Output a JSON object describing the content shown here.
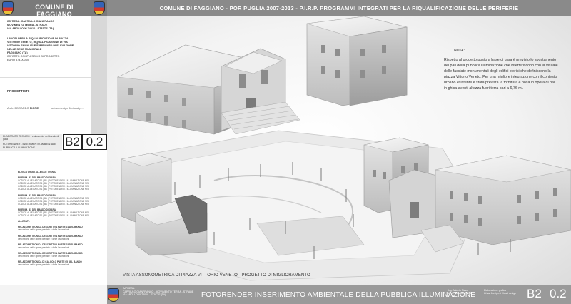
{
  "header": {
    "municipality": "COMUNE DI FAGGIANO",
    "program_title": "COMUNE DI FAGGIANO - POR PUGLIA 2007-2013 - P.I.R.P. PROGRAMMI INTEGRATI PER LA RIQUALIFICAZIONE DELLE PERIFERIE"
  },
  "info": {
    "impresa": "IMPRESA: CAPRIULO GIANFRANCO",
    "company": "MOVIMENTO TERRA - STRADE",
    "address": "VIA APOLLO XI 74010 - STATTE (TA)",
    "work_1": "LAVORI PER LA RIQUALIFICAZIONE DI PIAZZA",
    "work_2": "VITTORIO VENETO, RIQUALIFICAZIONE DI VIA",
    "work_3": "VITTORIO EMANUELE E IMPIANTO DI ELEVAZIONE",
    "work_4": "NELLE SEDE MUNICIPALE",
    "location": "FAGGIANO (TA)",
    "amount_label": "IMPORTO COMPLESSIVO DI PROGETTO",
    "amount": "EURO 574.000,00"
  },
  "designers": {
    "title": "PROGETTISTI:",
    "arch_prefix": "Arch. EDOARDO",
    "arch_surname": "FIORE",
    "arch_role": "urban design & visual p..."
  },
  "drawing": {
    "label_top": "ELABORATO TECNICO - elaboro del del bando di gara",
    "label_main": "FOTORENDER - INSERIMENTO AMBIENTALE PUBBLICA ILLUMINAZIONE",
    "code_b2": "B2",
    "code_02": "0.2"
  },
  "legend": {
    "heading_1": "ELENCO DEGLI ALLEGATI TECNICI",
    "group_a": "RIFERIM. B1 DEL BANDO DI GARA",
    "group_b": "RIFERIM. B2 DEL BANDO DI GARA",
    "group_c": "RIFERIM. B3 DEL BANDO DI GARA",
    "item": "CODICE ALLEGATO B1 | B1 | FOTORENDER - ILLUMINAZIONE NELLE AREE PUBBLICHE",
    "heading_2": "ALLEGATI:",
    "report_1": "RELAZIONE TECNICA DESCRITTIVA PARTE 01 DEL BANDO",
    "report_2": "RELAZIONE TECNICA DESCRITTIVA PARTE 02 DEL BANDO",
    "report_3": "RELAZIONE TECNICA DESCRITTIVA PARTE 03 DEL BANDO",
    "report_4": "RELAZIONE TECNICA DESCRITTIVA PARTE 04 DEL BANDO",
    "report_5": "RELAZIONE TECNICA DI CALCOLO PARTE 05 DEL BANDO",
    "report_desc": "descrizione delle opere previste e delle lavorazioni"
  },
  "render": {
    "caption": "VISTA ASSONOMETRICA DI PIAZZA VITTORIO VENETO - PROGETTO DI MIGLIORAMENTO",
    "note_title": "NOTA:",
    "note_text": "Rispetto al progetto posto a base di gara è previsto lo spostamento dei pali della pubblica illuminazione che interferiscono con la visuale delle facciate monumentali degli edifici storici che definiscono la piazza Vittorio Veneto. Per una migliore integrazione con il contesto urbano esistente è stata prevista la fornitura e posa in opera di pali in ghisa aventi altezza fuori terra pari a 6,76 ml."
  },
  "footer": {
    "info_1": "IMPRESA:",
    "info_2": "CAPRIULO GIANFRANCO - MOVIMENTO TERRA - STRADE",
    "info_3": "VIA APOLLO XI 74010 - STATTE (TA)",
    "title": "FOTORENDER INSERIMENTO AMBIENTALE DELLA PUBBLICA ILLUMINAZIONE",
    "small_1a": "Ing. Antonio Rizzo",
    "small_1b": "Arch. Edoardo FIORE",
    "small_2a": "Elaborazione grafica",
    "small_2b": "Urban Design & Visual design",
    "code_b2": "B2",
    "code_02": "0.2"
  },
  "colors": {
    "header_grey": "#8a8a8a",
    "footer_grey": "#9a9a9a"
  }
}
